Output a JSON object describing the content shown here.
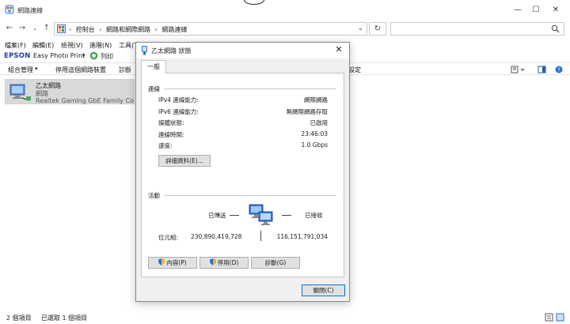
{
  "window": {
    "title": "網路連線",
    "controls": {
      "minimize": "—",
      "maximize": "☐",
      "close": "✕"
    }
  },
  "address": {
    "back": "←",
    "forward": "→",
    "dropdown": "⌄",
    "up": "↑",
    "breadcrumbs": [
      "控制台",
      "網路和網際網路",
      "網路連線"
    ],
    "separator": "›",
    "refresh": "↻",
    "search_placeholder": ""
  },
  "menu": {
    "items": [
      "檔案(F)",
      "編輯(E)",
      "檢視(V)",
      "進階(N)",
      "工具(T)"
    ]
  },
  "epson": {
    "brand": "EPSON",
    "app": "Easy Photo Print",
    "dropdown": "▾",
    "print": "列印"
  },
  "commands": {
    "organize": "組合管理",
    "organize_dd": "▾",
    "disable": "停用這個網路裝置",
    "diagnose": "診斷",
    "settings_tail": "設定"
  },
  "network_item": {
    "name": "乙太網路",
    "status": "網路",
    "adapter": "Realtek Gaming GbE Family Co..."
  },
  "statusbar": {
    "count": "2 個項目",
    "selected": "已選取 1 個項目"
  },
  "dialog": {
    "title": "乙太網路 狀態",
    "close": "✕",
    "tab": "一般",
    "connection": {
      "label": "連線",
      "rows": [
        {
          "label": "IPv4 連線能力:",
          "value": "網際網路"
        },
        {
          "label": "IPv6 連線能力:",
          "value": "無網際網路存取"
        },
        {
          "label": "媒體狀態:",
          "value": "已啟用"
        },
        {
          "label": "連線時間:",
          "value": "23:46:03"
        },
        {
          "label": "速度:",
          "value": "1.0 Gbps"
        }
      ],
      "details_button": "詳細資料(E)..."
    },
    "activity": {
      "label": "活動",
      "sent_label": "已傳送",
      "received_label": "已接收",
      "bytes_label": "位元組:",
      "bytes_sent": "230,890,419,728",
      "bytes_received": "116,151,791,034"
    },
    "buttons": {
      "properties": "內容(P)",
      "disable": "停用(D)",
      "diagnose": "診斷(G)",
      "close": "關閉(C)"
    }
  }
}
